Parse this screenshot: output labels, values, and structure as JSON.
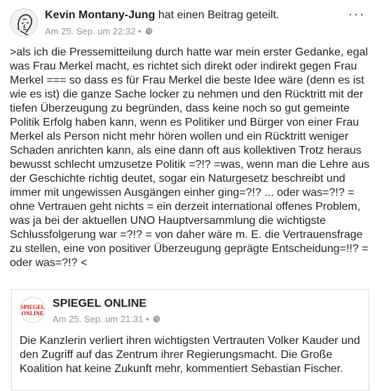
{
  "post": {
    "author": "Kevin Montany-Jung",
    "action": "hat einen Beitrag geteilt.",
    "timestamp": "Am 25. Sep. um 22:32 •",
    "privacy_icon": "globe-icon",
    "menu_label": "···",
    "text": ">als ich die Pressemitteilung durch hatte war mein erster Gedanke, egal\nwas Frau Merkel macht, es richtet sich direkt oder indirekt gegen Frau\nMerkel  === so dass es für Frau Merkel die beste Idee wäre (denn es ist\nwie es ist) die ganze Sache locker zu nehmen und den Rücktritt mit der\ntiefen Überzeugung zu begründen, dass keine noch so gut gemeinte\nPolitik Erfolg haben kann, wenn es Politiker und Bürger von einer Frau\nMerkel als Person nicht mehr hören wollen  und ein Rücktritt  weniger\nSchaden anrichten kann, als eine dann oft aus kollektiven  Trotz  heraus\nbewusst schlecht umzusetze Politik =?!? =was, wenn man die Lehre aus\nder Geschichte richtig deutet, sogar ein Naturgesetz beschreibt und\nimmer mit ungewissen Ausgängen einher ging=?!? ... oder was=?!? =\nohne Vertrauen geht nichts = ein derzeit international offenes Problem,\nwas ja bei der aktuellen UNO Hauptversammlung die wichtigste\nSchlussfolgerung war =?!? = von daher wäre m. E. die Vertrauensfrage\nzu stellen, eine von positiver Überzeugung geprägte Entscheidung=!!? =\noder was=?!? <"
  },
  "shared": {
    "logo_line1": "SPIEGEL",
    "logo_line2": "ONLINE",
    "page_name": "SPIEGEL ONLINE",
    "timestamp": "Am 25. Sep. um 21:31 •",
    "privacy_icon": "globe-icon",
    "text": "Die Kanzlerin verliert ihren wichtigsten Vertrauten Volker Kauder und\nden Zugriff auf das Zentrum ihrer Regierungsmacht. Die Große\nKoalition hat keine Zukunft mehr, kommentiert Sebastian Fischer."
  },
  "colors": {
    "text": "#1d2129",
    "meta": "#90949c",
    "border": "#dadde1",
    "spiegel_red": "#cc0000"
  }
}
